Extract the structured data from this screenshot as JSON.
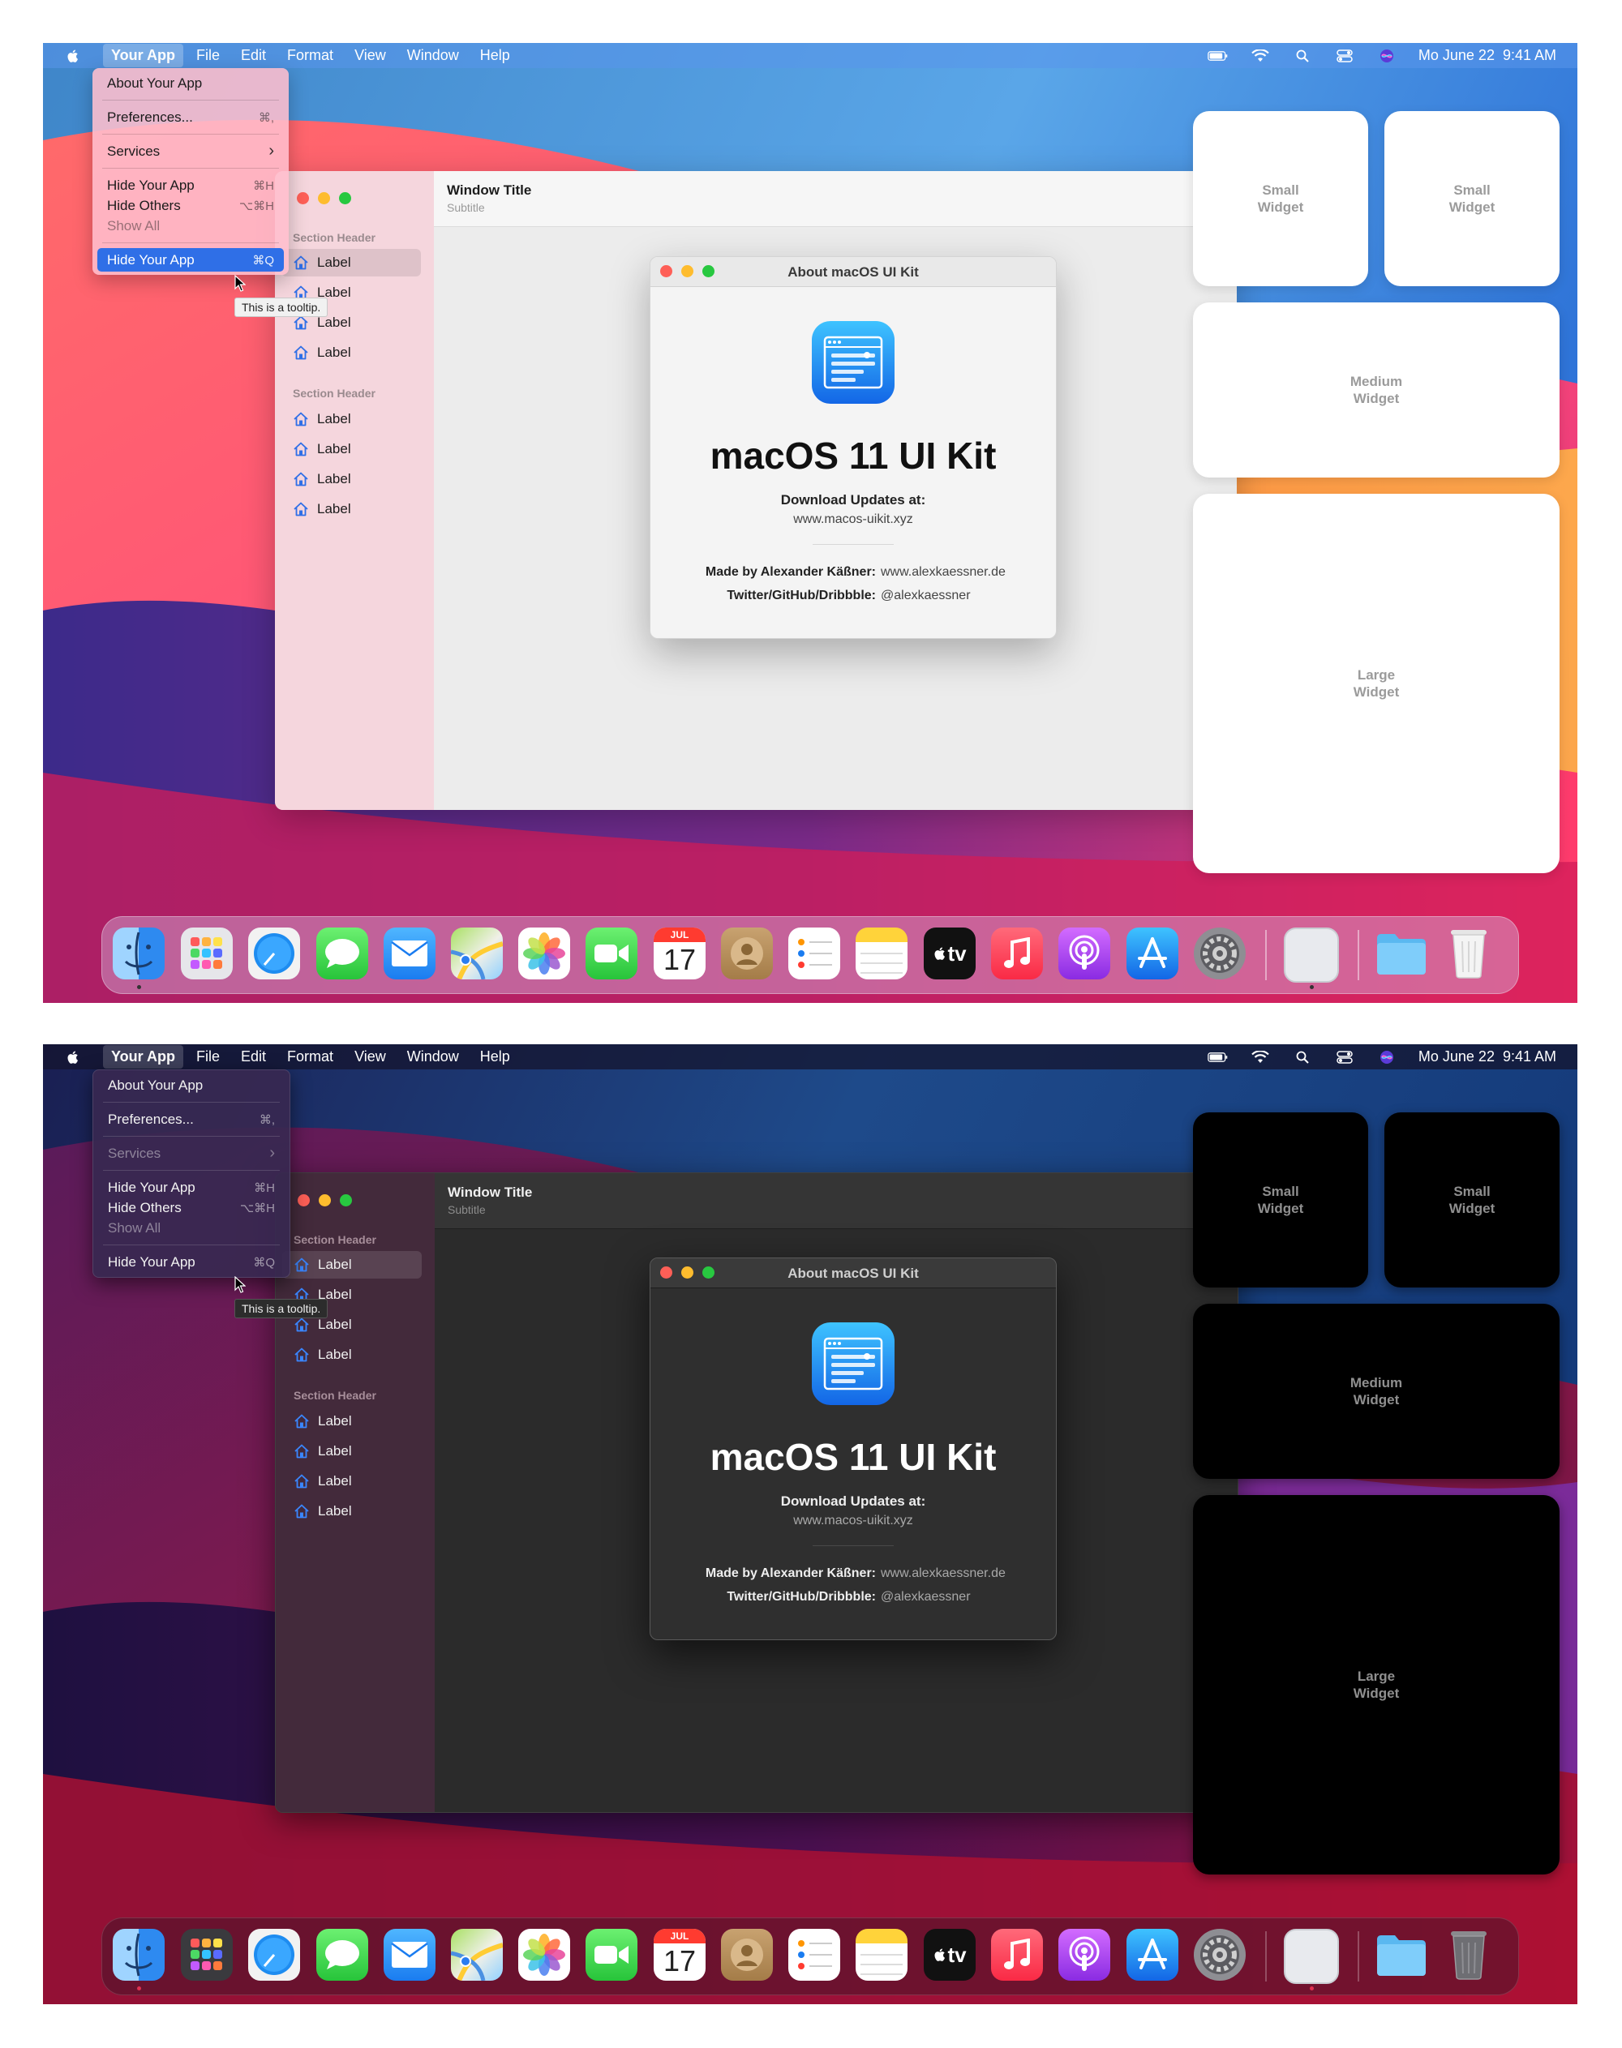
{
  "menubar": {
    "items": [
      {
        "label": "Your App"
      },
      {
        "label": "File"
      },
      {
        "label": "Edit"
      },
      {
        "label": "Format"
      },
      {
        "label": "View"
      },
      {
        "label": "Window"
      },
      {
        "label": "Help"
      }
    ],
    "status": {
      "date_time": "Mo June 22  9:41 AM",
      "icons": [
        "battery-icon",
        "wifi-icon",
        "spotlight-search-icon",
        "control-center-icon",
        "siri-icon"
      ]
    }
  },
  "app_menu": {
    "about": "About Your App",
    "preferences": "Preferences...",
    "preferences_shortcut": "⌘,",
    "services": "Services",
    "services_arrow": "›",
    "hide_app": "Hide Your App",
    "hide_app_shortcut": "⌘H",
    "hide_others": "Hide Others",
    "hide_others_shortcut": "⌥⌘H",
    "show_all": "Show All",
    "hide_app_2": "Hide Your App",
    "hide_app_2_shortcut": "⌘Q",
    "tooltip": "This is a tooltip."
  },
  "window": {
    "title": "Window Title",
    "subtitle": "Subtitle",
    "sidebar": {
      "section_header_1": "Section Header",
      "section_header_2": "Section Header",
      "items_1": [
        "Label",
        "Label",
        "Label",
        "Label"
      ],
      "items_2": [
        "Label",
        "Label",
        "Label",
        "Label"
      ]
    }
  },
  "about_dialog": {
    "title": "About macOS UI Kit",
    "heading": "macOS 11 UI Kit",
    "download_label": "Download Updates at:",
    "download_url": "www.macos-uikit.xyz",
    "made_by_label": "Made by Alexander Käßner:",
    "made_by_value": "www.alexkaessner.de",
    "social_label": "Twitter/GitHub/Dribbble:",
    "social_value": "@alexkaessner"
  },
  "widgets": {
    "small_1": "Small\nWidget",
    "small_2": "Small\nWidget",
    "medium": "Medium\nWidget",
    "large": "Large\nWidget"
  },
  "dock": {
    "apps": [
      "finder-icon",
      "launchpad-icon",
      "safari-icon",
      "messages-icon",
      "mail-icon",
      "maps-icon",
      "photos-icon",
      "facetime-icon",
      "calendar-icon",
      "contacts-icon",
      "reminders-icon",
      "notes-icon",
      "apple-tv-icon",
      "music-icon",
      "podcasts-icon",
      "app-store-icon",
      "system-preferences-icon",
      "blank-app-icon",
      "folder-icon",
      "trash-icon"
    ],
    "calendar_month": "JUL",
    "calendar_day": "17",
    "tv_label": "tv"
  },
  "colors": {
    "accent": "#2f6fe7",
    "traffic_red": "#fe5f57",
    "traffic_yellow": "#febc2e",
    "traffic_green": "#28c840"
  }
}
